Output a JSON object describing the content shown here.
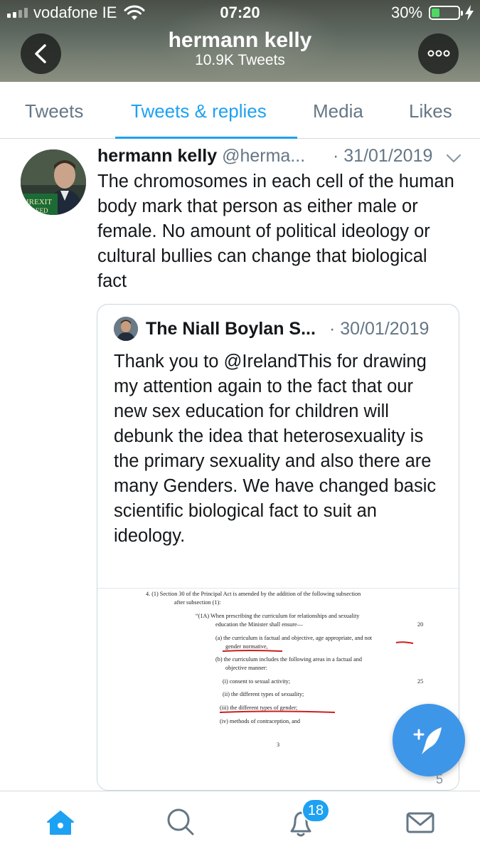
{
  "status_bar": {
    "carrier": "vodafone IE",
    "time": "07:20",
    "battery_percent": "30%",
    "battery_level": 0.3,
    "battery_color": "#4cd964"
  },
  "header": {
    "name": "hermann kelly",
    "tweet_count": "10.9K Tweets",
    "back_icon": "chevron-left-icon",
    "more_icon": "more-dots-icon"
  },
  "tabs": [
    {
      "label": "Tweets",
      "active": false
    },
    {
      "label": "Tweets & replies",
      "active": true
    },
    {
      "label": "Media",
      "active": false
    },
    {
      "label": "Likes",
      "active": false
    }
  ],
  "tweet": {
    "author_name": "hermann kelly",
    "author_handle": "@herma...",
    "date": "· 31/01/2019",
    "avatar_text": [
      "IREXIT",
      "FREED"
    ],
    "text": "The chromosomes in each cell of the human body mark that person as either male or female. No amount of political ideology or cultural bullies can change that biological fact",
    "quoted": {
      "author_name": "The Niall Boylan S...",
      "date": "· 30/01/2019",
      "text": "Thank you to @IrelandThis for drawing my attention again to the fact that our new sex education for children will debunk the idea that heterosexuality is the primary sexuality and also there are many Genders. We have changed basic scientific biological fact to suit an ideology.",
      "document": {
        "lines": [
          "4.   (1) Section 30 of the Principal Act is amended by the addition of the following subsection",
          "after subsection (1):",
          "“(1A) When prescribing the curriculum for relationships and sexuality",
          "education the Minister shall ensure—",
          "(a) the curriculum is factual and objective, age appropriate, and not",
          "gender normative,",
          "(b) the curriculum includes the following areas in a factual and",
          "objective manner:",
          "(i)  consent to sexual activity;",
          "(ii)  the different types of sexuality;",
          "(iii)  the different types of gender;",
          "(iv)  methods of contraception, and",
          "3"
        ],
        "line_numbers": [
          "20",
          "25"
        ],
        "underline_color": "#cc1f1f"
      }
    }
  },
  "fab": {
    "icon": "compose-tweet-icon",
    "peek_count": "5"
  },
  "bottom_nav": {
    "items": [
      "home-icon",
      "search-icon",
      "notifications-icon",
      "messages-icon"
    ],
    "notifications_badge": "18",
    "active_color": "#1da1f2"
  }
}
